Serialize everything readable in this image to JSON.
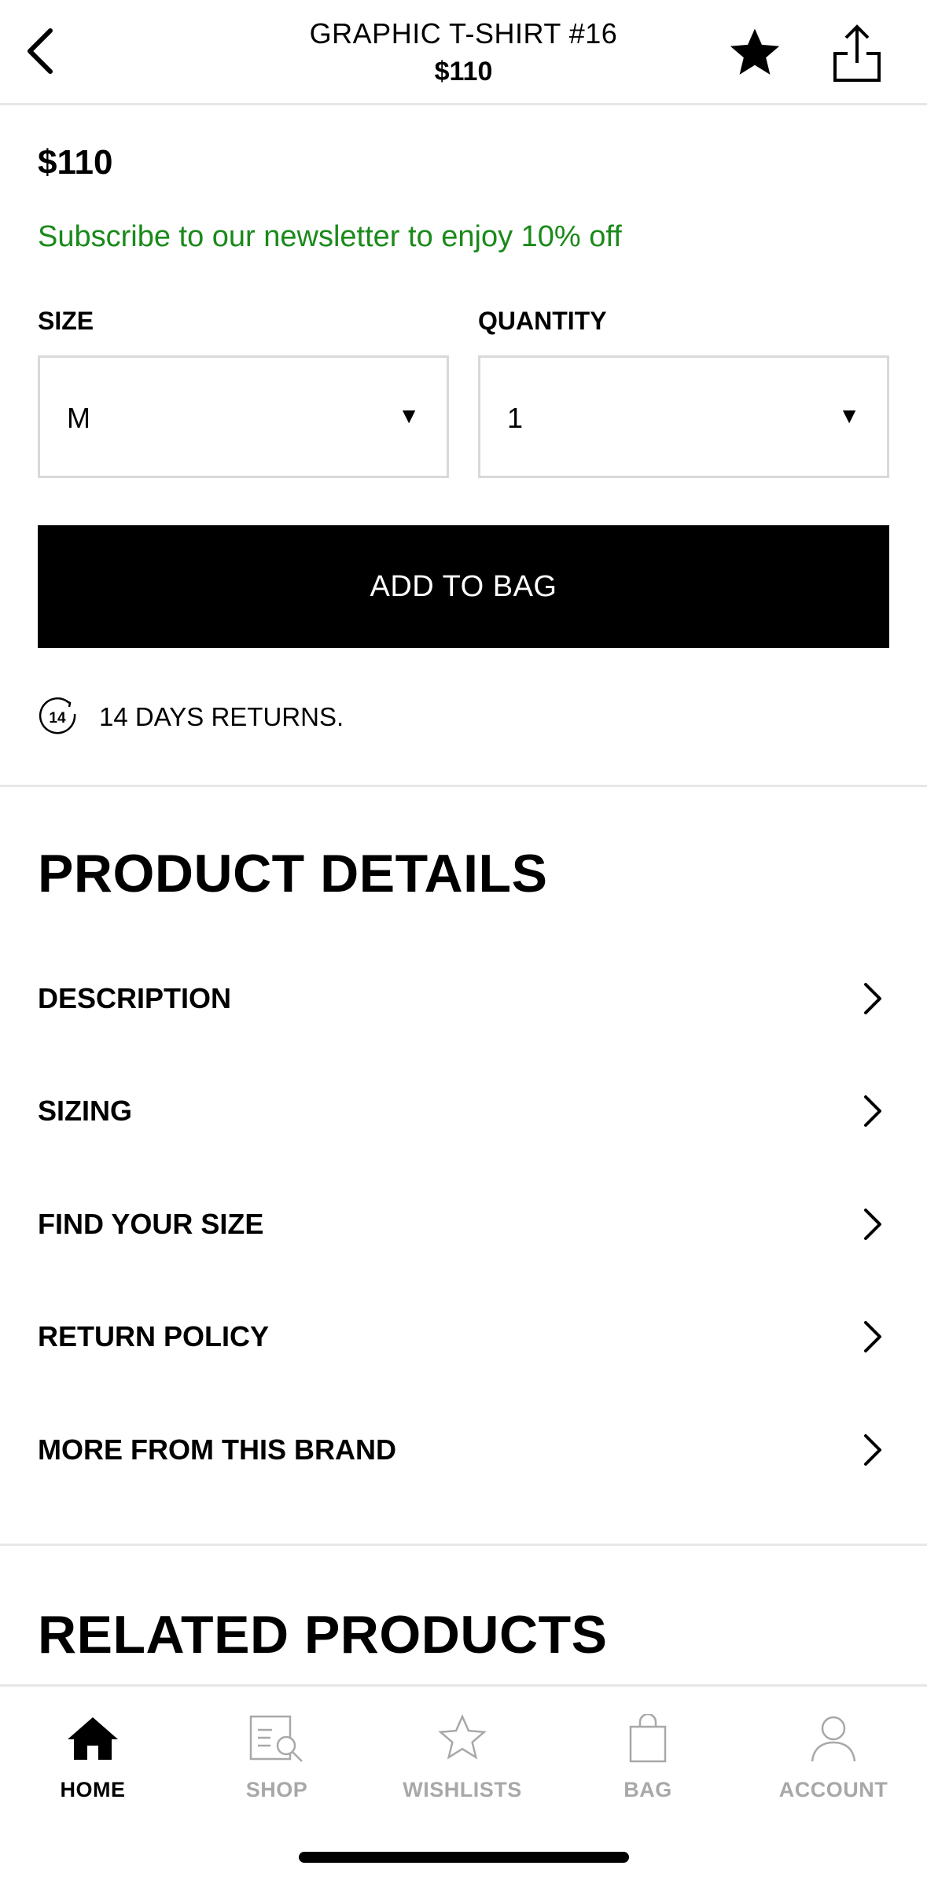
{
  "header": {
    "title": "GRAPHIC T-SHIRT #16",
    "price": "$110",
    "back_icon": "chevron-left-icon",
    "favorite_icon": "star-icon",
    "share_icon": "share-icon"
  },
  "product": {
    "price": "$110",
    "promo": "Subscribe to our newsletter to enjoy 10% off",
    "promo_color": "#1a8a1a"
  },
  "options": {
    "size_label": "SIZE",
    "size_value": "M",
    "quantity_label": "QUANTITY",
    "quantity_value": "1",
    "dropdown_arrow": "▼"
  },
  "cta": {
    "add_to_bag": "ADD TO BAG"
  },
  "returns": {
    "icon_text": "14",
    "text": "14 DAYS RETURNS."
  },
  "details": {
    "title": "PRODUCT DETAILS",
    "items": [
      {
        "label": "DESCRIPTION"
      },
      {
        "label": "SIZING"
      },
      {
        "label": "FIND YOUR SIZE"
      },
      {
        "label": "RETURN POLICY"
      },
      {
        "label": "MORE FROM THIS BRAND"
      }
    ]
  },
  "related": {
    "title": "RELATED PRODUCTS"
  },
  "tabbar": {
    "items": [
      {
        "label": "HOME",
        "icon": "home-icon",
        "active": true
      },
      {
        "label": "SHOP",
        "icon": "shop-search-icon",
        "active": false
      },
      {
        "label": "WISHLISTS",
        "icon": "star-outline-icon",
        "active": false
      },
      {
        "label": "BAG",
        "icon": "bag-icon",
        "active": false
      },
      {
        "label": "ACCOUNT",
        "icon": "account-icon",
        "active": false
      }
    ]
  }
}
